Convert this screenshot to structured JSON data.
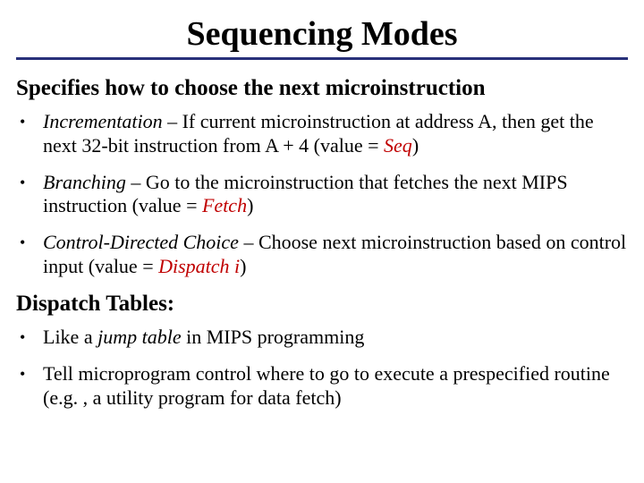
{
  "title": "Sequencing Modes",
  "heading1": "Specifies how to choose the next microinstruction",
  "bullets1": {
    "b1": {
      "term": "Incrementation",
      "dash": " – ",
      "desc": "If current microinstruction at address A, then get the next 32-bit instruction from A + 4  (value = ",
      "val": "Seq",
      "close": ")"
    },
    "b2": {
      "term": "Branching",
      "dash": " – ",
      "desc": "Go to the microinstruction that fetches the next MIPS instruction (value = ",
      "val": "Fetch",
      "close": ")"
    },
    "b3": {
      "term": "Control-Directed Choice",
      "dash": " – ",
      "desc": "Choose next microinstruction based on control input (value = ",
      "val": "Dispatch i",
      "close": ")"
    }
  },
  "heading2": "Dispatch Tables:",
  "bullets2": {
    "b1": {
      "pre": "Like a ",
      "term": "jump table",
      "post": "  in MIPS programming"
    },
    "b2": {
      "text": "Tell microprogram control where to go to execute a prespecified routine (e.g. , a utility program for data fetch)"
    }
  },
  "marker": "•"
}
